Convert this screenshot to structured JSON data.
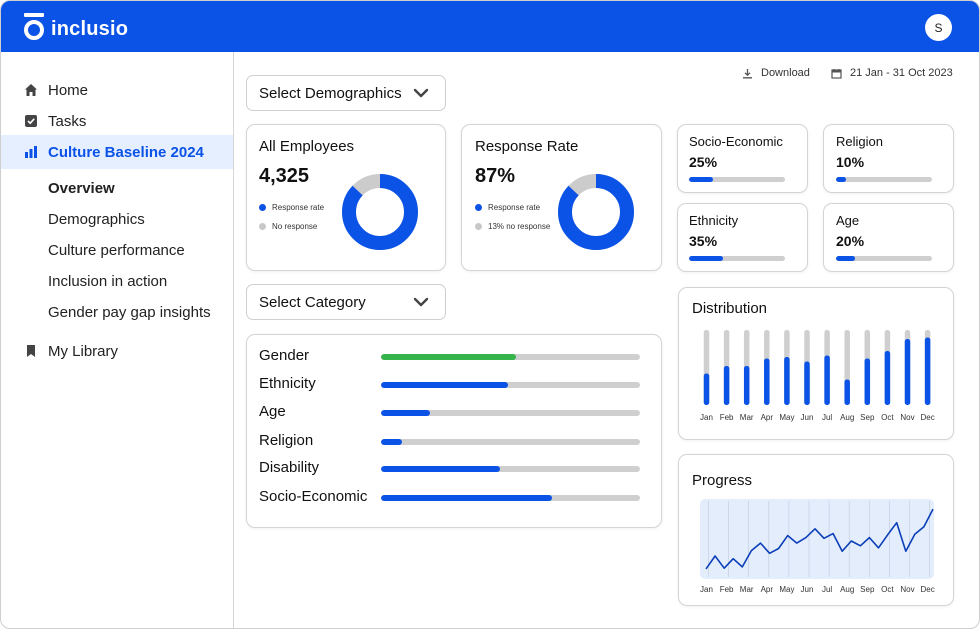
{
  "app": {
    "name": "inclusio",
    "avatar_initial": "S"
  },
  "sidebar": {
    "items": [
      {
        "label": "Home",
        "icon": "home-icon"
      },
      {
        "label": "Tasks",
        "icon": "checkbox-icon"
      },
      {
        "label": "Culture Baseline 2024",
        "icon": "bar-chart-icon",
        "active": true
      },
      {
        "label": "My Library",
        "icon": "bookmark-icon"
      }
    ],
    "sub_items": [
      "Overview",
      "Demographics",
      "Culture performance",
      "Inclusion in action",
      "Gender pay gap insights"
    ]
  },
  "toolbar": {
    "demographics_select": "Select Demographics",
    "category_select": "Select Category",
    "download_label": "Download",
    "date_range": "21 Jan - 31 Oct 2023"
  },
  "employees_card": {
    "title": "All Employees",
    "value": "4,325",
    "legend": [
      "Response rate",
      "No response"
    ],
    "response_fraction": 0.87
  },
  "response_card": {
    "title": "Response Rate",
    "value": "87%",
    "legend": [
      "Response rate",
      "13% no response"
    ],
    "response_fraction": 0.87
  },
  "mini_cards": [
    {
      "title": "Socio-Economic",
      "value": "25%",
      "fraction": 0.25
    },
    {
      "title": "Religion",
      "value": "10%",
      "fraction": 0.1
    },
    {
      "title": "Ethnicity",
      "value": "35%",
      "fraction": 0.35
    },
    {
      "title": "Age",
      "value": "20%",
      "fraction": 0.2
    }
  ],
  "category_bars": [
    {
      "label": "Gender",
      "fraction": 0.52,
      "color": "#34b44a"
    },
    {
      "label": "Ethnicity",
      "fraction": 0.49,
      "color": "#0b53e6"
    },
    {
      "label": "Age",
      "fraction": 0.19,
      "color": "#0b53e6"
    },
    {
      "label": "Religion",
      "fraction": 0.08,
      "color": "#0b53e6"
    },
    {
      "label": "Disability",
      "fraction": 0.46,
      "color": "#0b53e6"
    },
    {
      "label": "Socio-Economic",
      "fraction": 0.66,
      "color": "#0b53e6"
    }
  ],
  "colors": {
    "accent": "#0b53e6",
    "track": "#cfcfcf",
    "green": "#34b44a"
  },
  "chart_data": [
    {
      "type": "bar",
      "title": "Distribution",
      "categories": [
        "Jan",
        "Feb",
        "Mar",
        "Apr",
        "May",
        "Jun",
        "Jul",
        "Aug",
        "Sep",
        "Oct",
        "Nov",
        "Dec"
      ],
      "values": [
        0.42,
        0.52,
        0.52,
        0.62,
        0.64,
        0.58,
        0.66,
        0.34,
        0.62,
        0.72,
        0.88,
        0.9
      ],
      "ylim": [
        0,
        1
      ]
    },
    {
      "type": "line",
      "title": "Progress",
      "categories": [
        "Jan",
        "Feb",
        "Mar",
        "Apr",
        "May",
        "Jun",
        "Jul",
        "Aug",
        "Sep",
        "Oct",
        "Nov",
        "Dec"
      ],
      "values": [
        0.06,
        0.25,
        0.07,
        0.21,
        0.09,
        0.33,
        0.44,
        0.29,
        0.36,
        0.55,
        0.44,
        0.52,
        0.65,
        0.51,
        0.58,
        0.32,
        0.47,
        0.4,
        0.52,
        0.37,
        0.56,
        0.74,
        0.32,
        0.57,
        0.68,
        0.94
      ],
      "ylim": [
        0,
        1
      ]
    }
  ]
}
